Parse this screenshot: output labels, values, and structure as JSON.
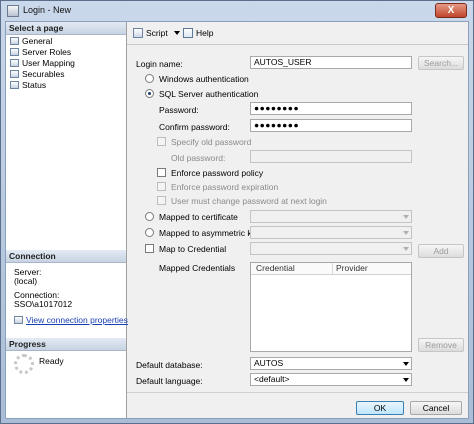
{
  "window": {
    "title": "Login - New",
    "close_glyph": "X"
  },
  "left_pane": {
    "select_page_heading": "Select a page",
    "pages": [
      "General",
      "Server Roles",
      "User Mapping",
      "Securables",
      "Status"
    ],
    "connection_heading": "Connection",
    "server_label": "Server:",
    "server_value": "(local)",
    "connection_label": "Connection:",
    "connection_value": "SSO\\a1017012",
    "view_connection_link": "View connection properties",
    "progress_heading": "Progress",
    "progress_status": "Ready"
  },
  "toolbar": {
    "script_label": "Script",
    "help_label": "Help"
  },
  "form": {
    "login_name_label": "Login name:",
    "login_name_value": "AUTOS_USER",
    "search_button": "Search...",
    "windows_auth_label": "Windows authentication",
    "sql_auth_label": "SQL Server authentication",
    "selected_auth": "sql",
    "password_label": "Password:",
    "password_value": "●●●●●●●●",
    "confirm_password_label": "Confirm password:",
    "confirm_password_value": "●●●●●●●●",
    "specify_old_password_label": "Specify old password",
    "old_password_label": "Old password:",
    "enforce_policy_label": "Enforce password policy",
    "enforce_expiration_label": "Enforce password expiration",
    "must_change_label": "User must change password at next login",
    "mapped_certificate_label": "Mapped to certificate",
    "mapped_asymmetric_label": "Mapped to asymmetric key",
    "map_credential_label": "Map to Credential",
    "add_button": "Add",
    "mapped_credentials_label": "Mapped Credentials",
    "credentials_columns": [
      "Credential",
      "Provider"
    ],
    "remove_button": "Remove",
    "default_database_label": "Default database:",
    "default_database_value": "AUTOS",
    "default_language_label": "Default language:",
    "default_language_value": "<default>"
  },
  "footer": {
    "ok_button": "OK",
    "cancel_button": "Cancel"
  },
  "colors": {
    "link": "#1a3fb5",
    "default_button_border": "#3c7fb1"
  }
}
